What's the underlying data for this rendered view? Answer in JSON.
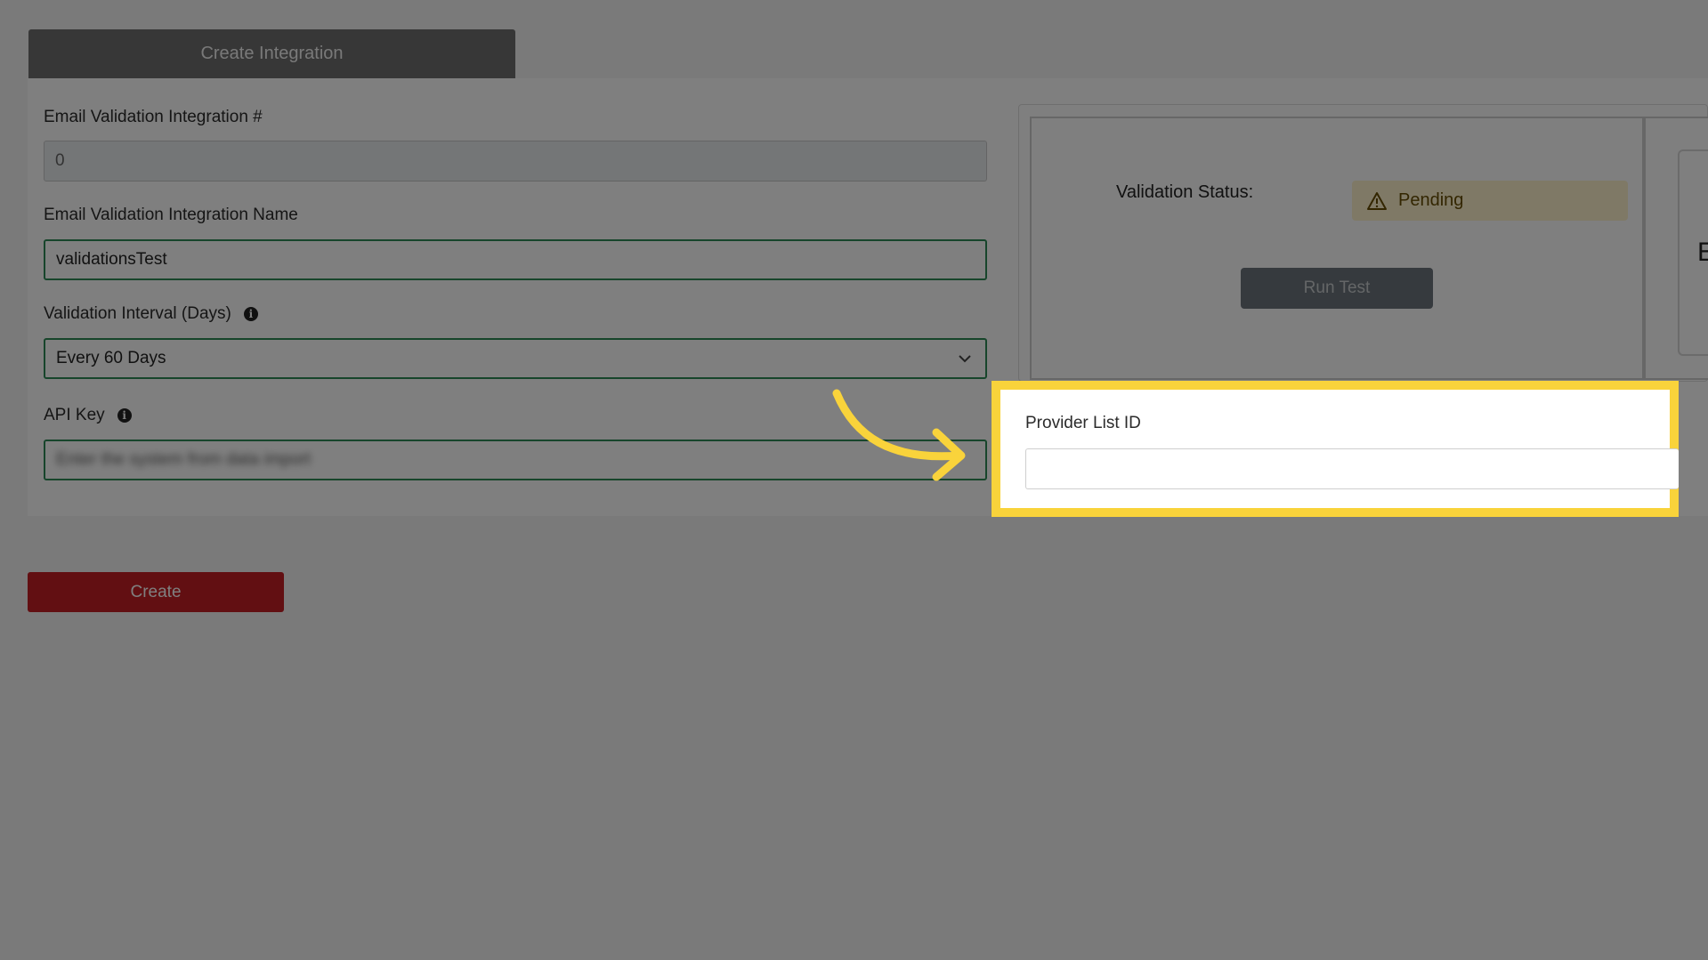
{
  "tab": {
    "label": "Create Integration"
  },
  "form": {
    "integration_number": {
      "label": "Email Validation Integration #",
      "value": "0"
    },
    "integration_name": {
      "label": "Email Validation Integration Name",
      "value": "validationsTest"
    },
    "interval": {
      "label": "Validation Interval (Days)",
      "value": "Every 60 Days"
    },
    "api_key": {
      "label": "API Key",
      "value": "Enter the system from data import"
    }
  },
  "status": {
    "label": "Validation Status:",
    "badge": "Pending",
    "run_test_label": "Run Test",
    "side_card_letter": "E"
  },
  "provider_list": {
    "label": "Provider List ID",
    "value": ""
  },
  "create_button": {
    "label": "Create"
  },
  "colors": {
    "highlight": "#f9d33b",
    "valid_border": "#2e8b57",
    "create_button": "#c41e24",
    "pending_bg": "#fff3cd"
  }
}
